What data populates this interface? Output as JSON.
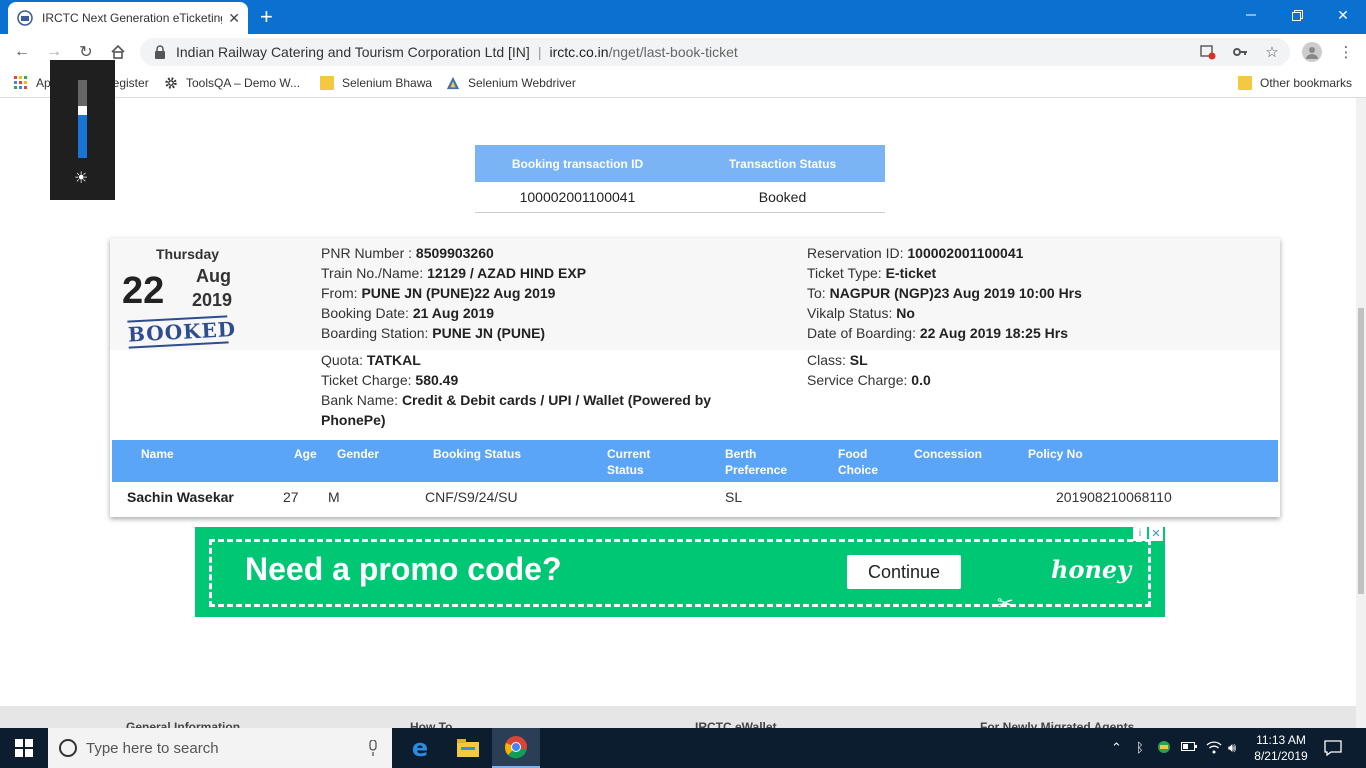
{
  "browser": {
    "tab_title": "IRCTC Next Generation eTicketing",
    "site_name": "Indian Railway Catering and Tourism Corporation Ltd [IN]",
    "url_host": "irctc.co.in",
    "url_path": "/nget/last-book-ticket"
  },
  "bookmarks": {
    "apps": "Apps",
    "register": "Register",
    "toolsqa": "ToolsQA – Demo W...",
    "selenium_bhawa": "Selenium Bhawa",
    "selenium_webdriver": "Selenium Webdriver",
    "other": "Other bookmarks"
  },
  "brightness_level": 0.55,
  "transaction": {
    "headers": [
      "Booking transaction ID",
      "Transaction Status"
    ],
    "id": "100002001100041",
    "status": "Booked"
  },
  "journey": {
    "weekday": "Thursday",
    "day": "22",
    "month": "Aug",
    "year": "2019",
    "stamp": "BOOKED"
  },
  "details": {
    "pnr_label": "PNR Number :",
    "pnr": "8509903260",
    "train_label": "Train No./Name:",
    "train": "12129 / AZAD HIND EXP",
    "from_label": "From:",
    "from": "PUNE JN (PUNE)22 Aug 2019",
    "booking_date_label": "Booking Date:",
    "booking_date": "21 Aug 2019",
    "boarding_label": "Boarding Station:",
    "boarding": "PUNE JN (PUNE)",
    "quota_label": "Quota:",
    "quota": "TATKAL",
    "charge_label": "Ticket Charge:",
    "charge": "580.49",
    "bank_label": "Bank Name:",
    "bank_line1": "Credit & Debit cards / UPI / Wallet (Powered by",
    "bank_line2": "PhonePe)",
    "reservation_label": "Reservation ID:",
    "reservation": "100002001100041",
    "ticket_type_label": "Ticket Type:",
    "ticket_type": "E-ticket",
    "to_label": "To:",
    "to": "NAGPUR (NGP)23 Aug 2019 10:00 Hrs",
    "vikalp_label": "Vikalp Status:",
    "vikalp": "No",
    "doboarding_label": "Date of Boarding:",
    "doboarding": "22 Aug 2019 18:25 Hrs",
    "class_label": "Class:",
    "class": "SL",
    "service_label": "Service Charge:",
    "service": "0.0"
  },
  "passengers": {
    "headers": {
      "name": "Name",
      "age": "Age",
      "gender": "Gender",
      "booking_status": "Booking Status",
      "current_status_1": "Current",
      "current_status_2": "Status",
      "berth_1": "Berth",
      "berth_2": "Preference",
      "food_1": "Food",
      "food_2": "Choice",
      "concession": "Concession",
      "policy": "Policy No"
    },
    "rows": [
      {
        "name": "Sachin Wasekar",
        "age": "27",
        "gender": "M",
        "booking_status": "CNF/S9/24/SU",
        "current_status": "",
        "berth": "SL",
        "food": "",
        "concession": "",
        "policy": "201908210068110"
      }
    ]
  },
  "ad": {
    "headline": "Need a promo code?",
    "button": "Continue",
    "brand": "honey"
  },
  "footer_sections": [
    "General Information",
    "How To",
    "IRCTC eWallet",
    "For Newly Migrated Agents"
  ],
  "taskbar": {
    "search_placeholder": "Type here to search",
    "time": "11:13 AM",
    "date": "8/21/2019"
  },
  "colors": {
    "chrome_blue": "#0a71d1",
    "table_header": "#7ab4f5",
    "pax_header": "#5aa5f7",
    "stamp": "#2e4d8f",
    "ad_green": "#00c774",
    "taskbar": "#0b1d2e"
  }
}
